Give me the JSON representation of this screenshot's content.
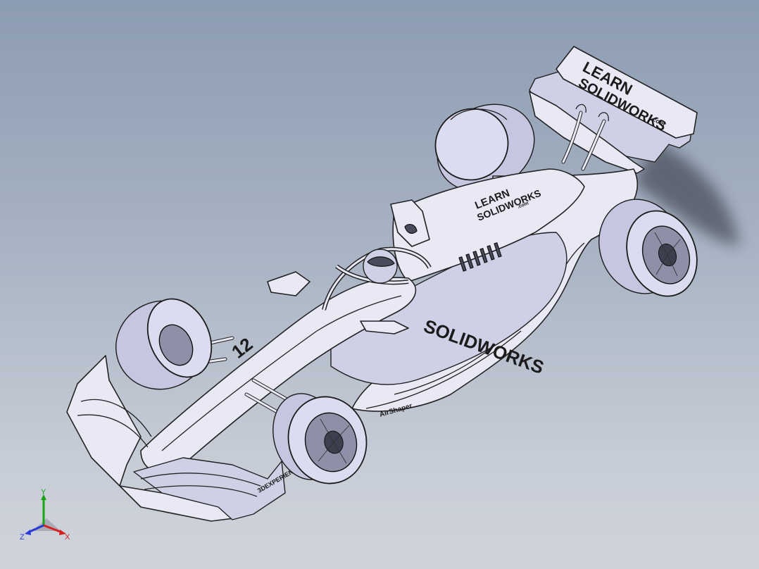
{
  "viewport": {
    "background_top": "#8c9cb2",
    "background_bottom": "#cfd3db"
  },
  "model": {
    "rear_wing_text_1": "LEARN",
    "rear_wing_text_2": "SOLIDWORKS",
    "rear_wing_text_3": ".com",
    "engine_cover_text_1": "LEARN",
    "engine_cover_text_2": "SOLIDWORKS",
    "engine_cover_text_3": ".com",
    "sidepod_text": "SOLIDWORKS",
    "car_number": "12",
    "sponsor_text": "AirShaper",
    "endplate_text": "3DEXPERIENCE"
  },
  "triad": {
    "x_label": "X",
    "y_label": "Y",
    "z_label": "Z",
    "x_color": "#d42020",
    "y_color": "#19a319",
    "z_color": "#2a3ad8"
  }
}
